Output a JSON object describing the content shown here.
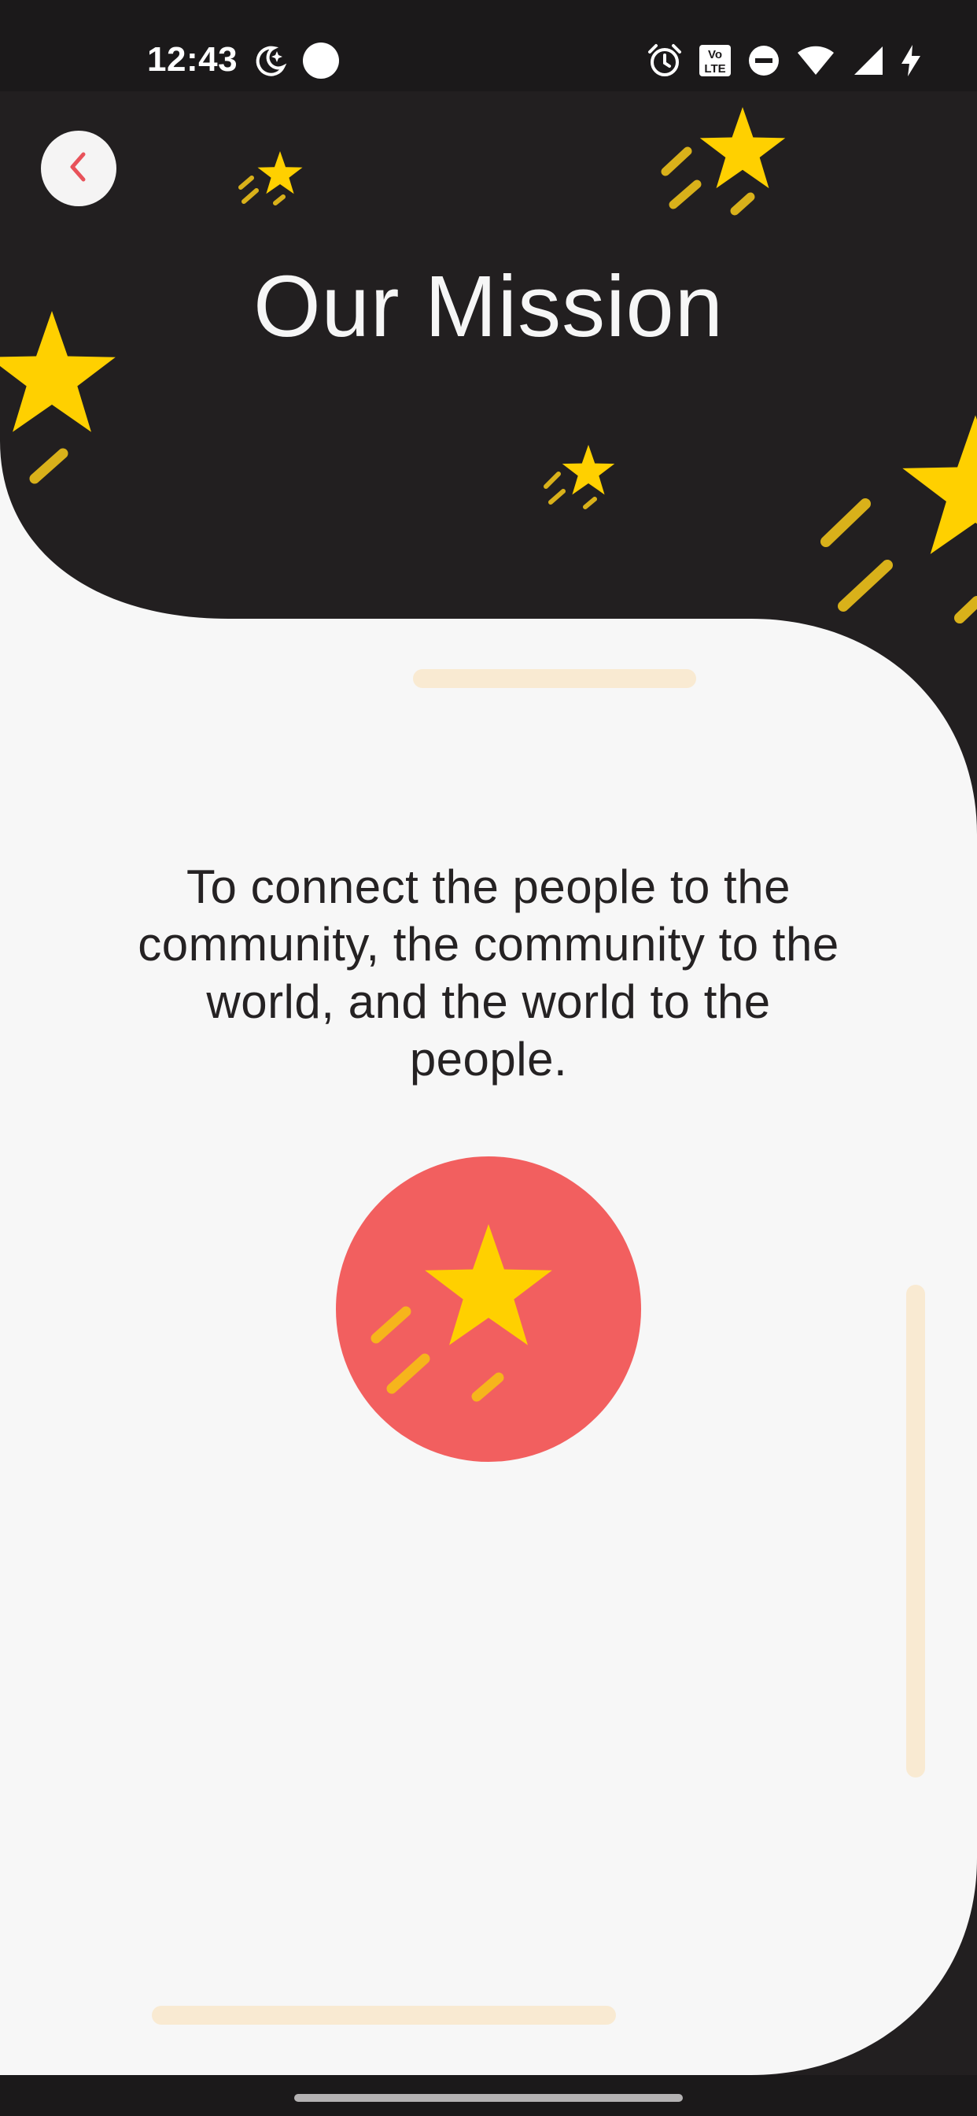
{
  "status_bar": {
    "time": "12:43",
    "left_icons": [
      "do-not-disturb-moon-icon",
      "circle-dot-icon"
    ],
    "right_icons": [
      "alarm-icon",
      "volte-icon",
      "dnd-minus-icon",
      "wifi-icon",
      "signal-icon",
      "charging-bolt-icon"
    ],
    "volte_label_top": "Vo",
    "volte_label_bottom": "LTE"
  },
  "header": {
    "title": "Our Mission",
    "back_icon": "chevron-left-icon"
  },
  "main": {
    "mission_statement": "To connect the people to the community, the community to the world, and the world to the people.",
    "badge_icon": "shooting-star-icon"
  },
  "colors": {
    "header_bg": "#221f20",
    "card_bg": "#f7f7f7",
    "accent_red": "#f25f5f",
    "star_yellow": "#ffd000",
    "streak_yellow": "#d9b11a",
    "pill": "#f9ead2",
    "back_chevron": "#e8525a"
  }
}
